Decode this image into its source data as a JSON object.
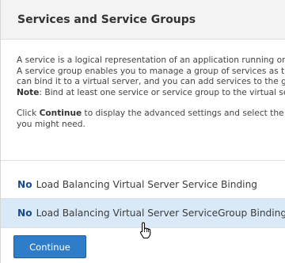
{
  "header": {
    "title": "Services and Service Groups"
  },
  "description": {
    "line1": "A service is a logical representation of an application running on",
    "line2": "A service group enables you to manage a group of services as th",
    "line3": "can bind it to a virtual server, and you can add services to the gr",
    "note_label": "Note",
    "note_text": ": Bind at least one service or service group to the virtual ser",
    "click_prefix": "Click ",
    "click_bold": "Continue",
    "click_suffix": " to display the advanced settings and select the n",
    "line_last": "you might need."
  },
  "bindings": [
    {
      "status": "No",
      "label": "Load Balancing Virtual Server Service Binding"
    },
    {
      "status": "No",
      "label": "Load Balancing Virtual Server ServiceGroup Binding"
    }
  ],
  "buttons": {
    "continue_label": "Continue"
  },
  "colors": {
    "accent": "#2f7cc9",
    "status_no": "#1a4a8f",
    "row_hover": "#d9e9f7",
    "header_bg": "#f3f3f3"
  }
}
